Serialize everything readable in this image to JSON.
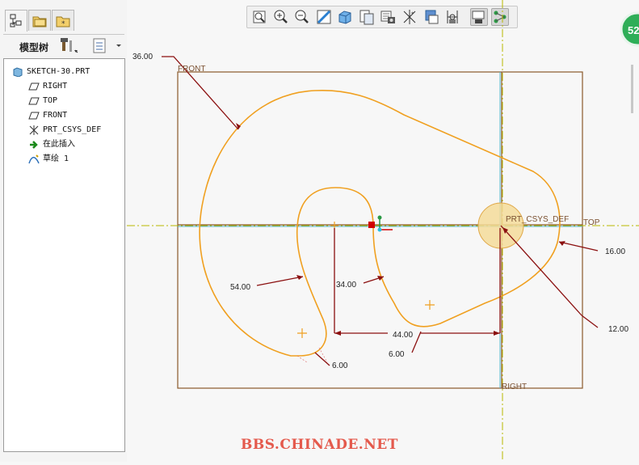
{
  "model_tree": {
    "title": "模型树",
    "items": [
      {
        "label": "SKETCH-30.PRT",
        "icon": "part-icon"
      },
      {
        "label": "RIGHT",
        "icon": "datum-plane-icon"
      },
      {
        "label": "TOP",
        "icon": "datum-plane-icon"
      },
      {
        "label": "FRONT",
        "icon": "datum-plane-icon"
      },
      {
        "label": "PRT_CSYS_DEF",
        "icon": "csys-icon"
      },
      {
        "label": "在此插入",
        "icon": "insert-arrow-icon"
      },
      {
        "label": "草绘 1",
        "icon": "sketch-icon"
      }
    ]
  },
  "toolbar": {
    "buttons": [
      "refit-icon",
      "zoom-in-icon",
      "zoom-out-icon",
      "repaint-icon",
      "saved-views-icon",
      "layers-icon",
      "view-manager-icon",
      "datum-display-icon",
      "annotation-display-icon",
      "spin-center-icon",
      "display-settings-icon",
      "model-tree-toggle-icon"
    ]
  },
  "sketch": {
    "datum_labels": {
      "front": "FRONT",
      "top": "TOP",
      "right": "RIGHT",
      "csys": "PRT_CSYS_DEF"
    },
    "dimensions": {
      "d1": "36.00",
      "d2": "16.00",
      "d3": "12.00",
      "d4": "54.00",
      "d5": "34.00",
      "d6": "44.00",
      "d7": "6.00",
      "d8": "6.00"
    },
    "colors": {
      "profile": "#f0a020",
      "dimension": "#8b1010",
      "datum": "#8a5a2a",
      "axis": "#b8b800",
      "accent": "#2a9a44"
    }
  },
  "watermark": "BBS.CHINADE.NET",
  "status_badge": "52"
}
